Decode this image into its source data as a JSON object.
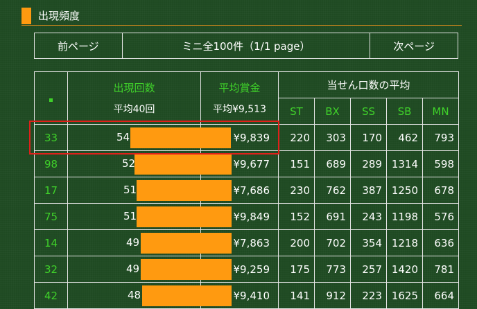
{
  "section": {
    "title": "出現頻度"
  },
  "pager": {
    "prev": "前ページ",
    "info": "ミニ全100件（1/1 page）",
    "next": "次ページ"
  },
  "table": {
    "header": {
      "marker": "■",
      "count_label": "出現回数",
      "count_avg": "平均40回",
      "prize_label": "平均賞金",
      "prize_avg": "平均¥9,513",
      "winners_label": "当せん口数の平均",
      "cols": [
        "ST",
        "BX",
        "SS",
        "SB",
        "MN"
      ]
    },
    "rows": [
      {
        "num": "33",
        "count": "54",
        "prize": "¥9,839",
        "st": "220",
        "bx": "303",
        "ss": "170",
        "sb": "462",
        "mn": "793"
      },
      {
        "num": "98",
        "count": "52",
        "prize": "¥9,677",
        "st": "151",
        "bx": "689",
        "ss": "289",
        "sb": "1314",
        "mn": "598"
      },
      {
        "num": "17",
        "count": "51",
        "prize": "¥7,686",
        "st": "230",
        "bx": "762",
        "ss": "387",
        "sb": "1250",
        "mn": "678"
      },
      {
        "num": "75",
        "count": "51",
        "prize": "¥9,849",
        "st": "152",
        "bx": "691",
        "ss": "243",
        "sb": "1198",
        "mn": "576"
      },
      {
        "num": "14",
        "count": "49",
        "prize": "¥7,863",
        "st": "200",
        "bx": "702",
        "ss": "354",
        "sb": "1218",
        "mn": "636"
      },
      {
        "num": "32",
        "count": "49",
        "prize": "¥9,259",
        "st": "175",
        "bx": "773",
        "ss": "257",
        "sb": "1420",
        "mn": "781"
      },
      {
        "num": "42",
        "count": "48",
        "prize": "¥9,410",
        "st": "141",
        "bx": "912",
        "ss": "223",
        "sb": "1625",
        "mn": "664"
      }
    ]
  },
  "colors": {
    "bar": "#ff9a10",
    "accent_green": "#3fd12a",
    "highlight": "#e0201a",
    "background": "#1f4a22"
  }
}
